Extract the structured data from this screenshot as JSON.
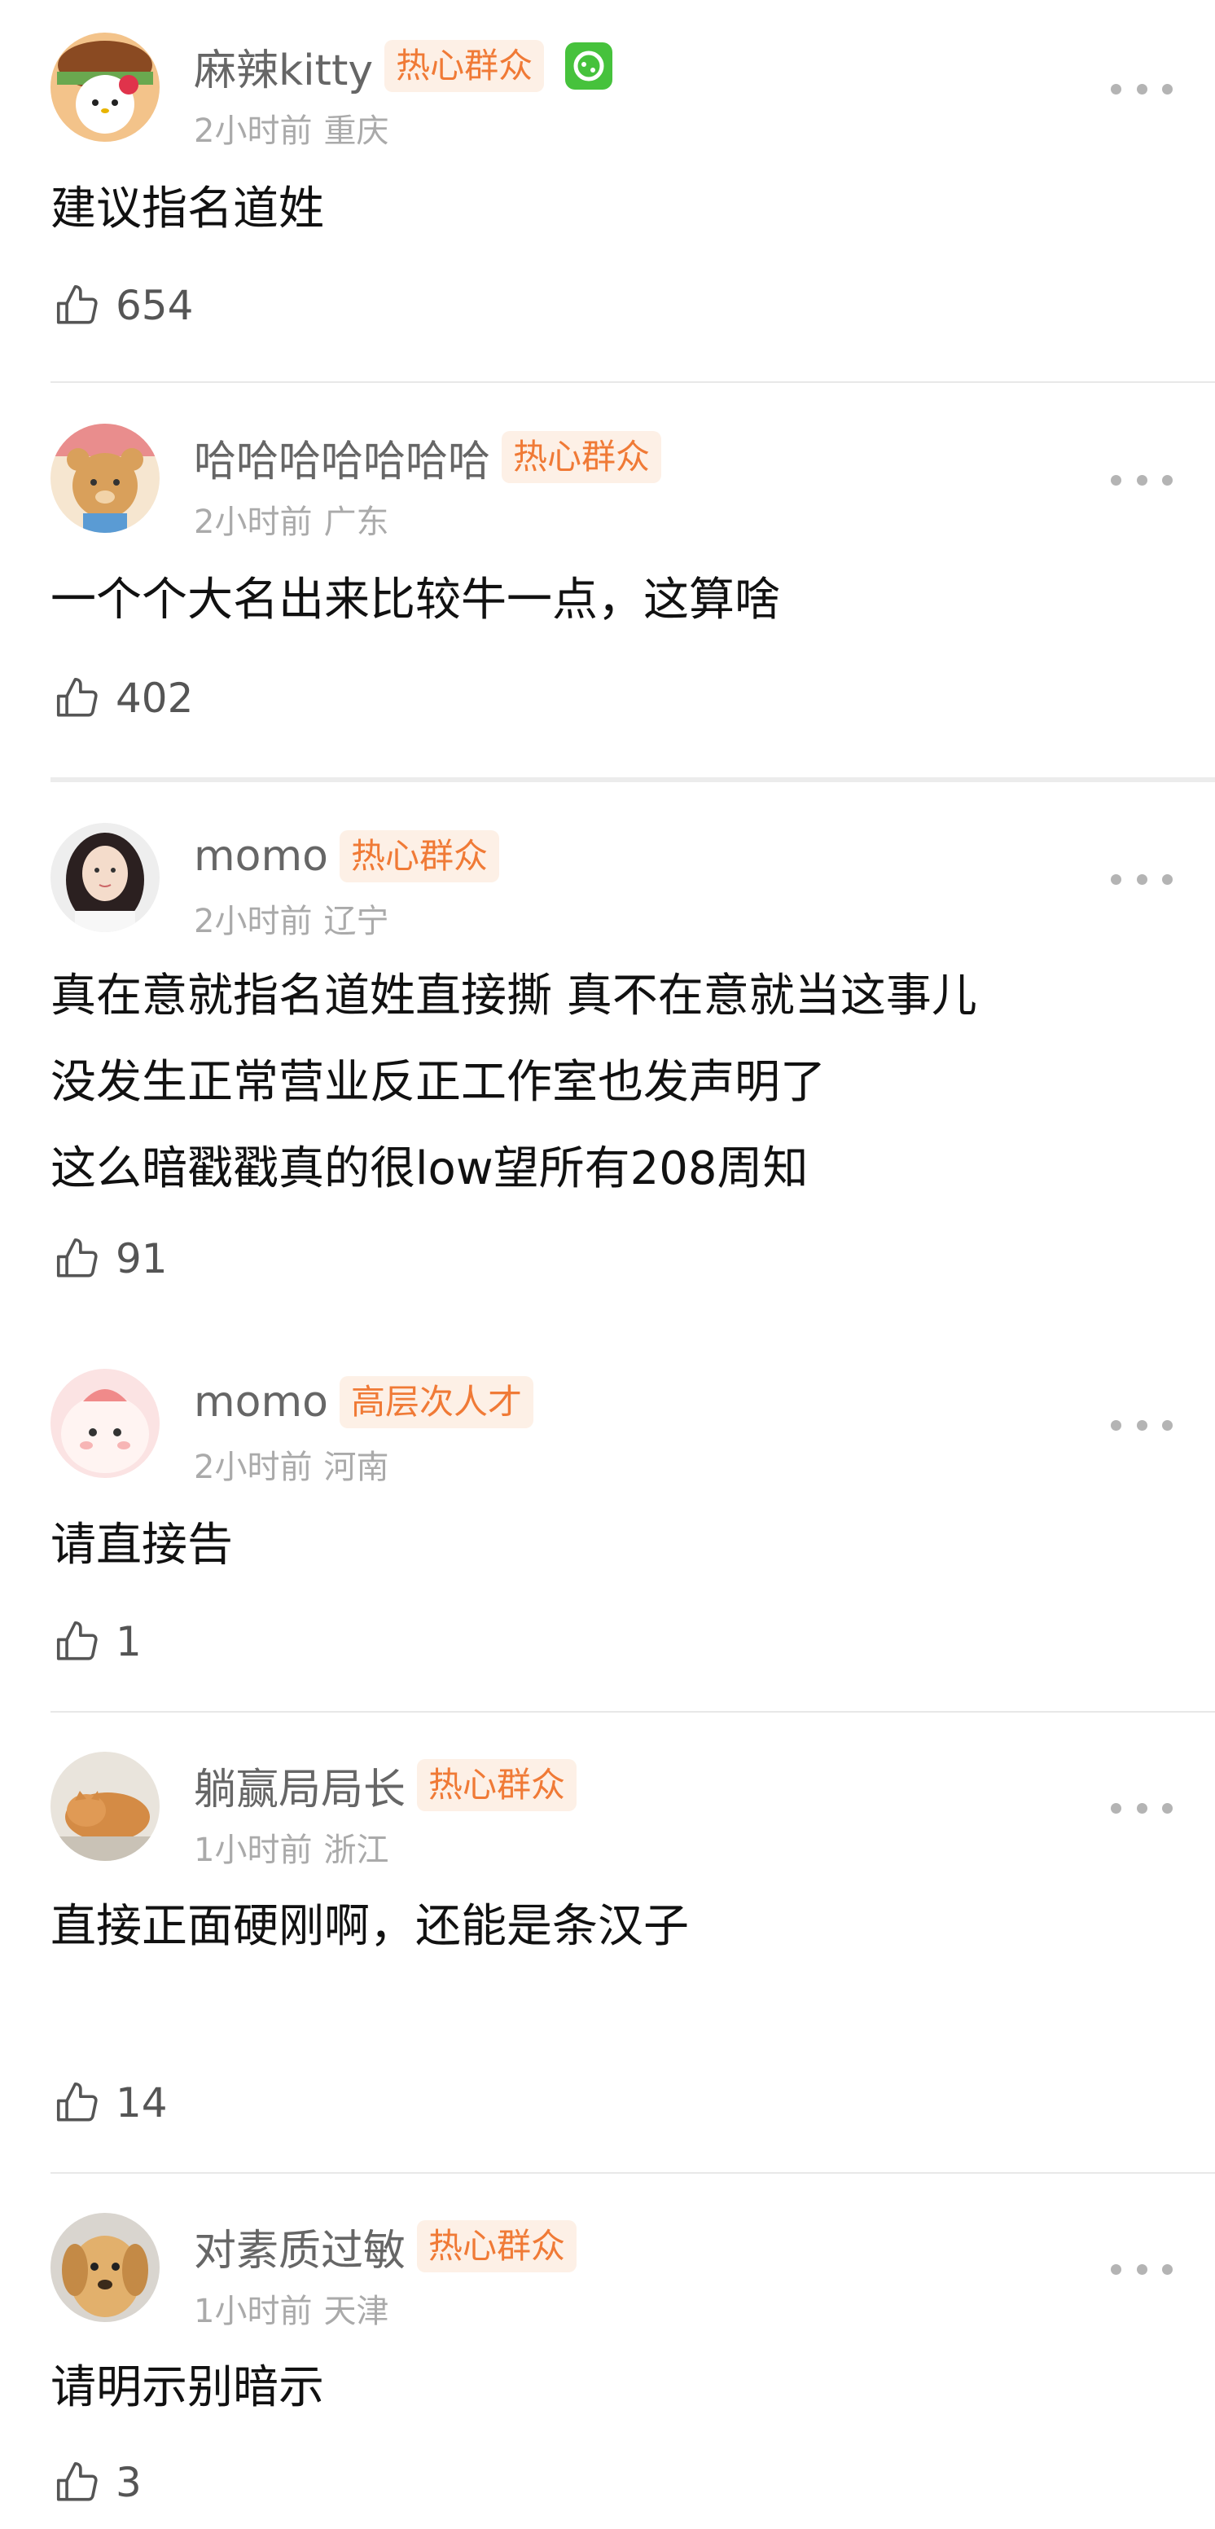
{
  "comments": [
    {
      "username": "麻辣kitty",
      "badge": "热心群众",
      "time": "2小时前",
      "location": "重庆",
      "lines": [
        "建议指名道姓"
      ],
      "likes": "654"
    },
    {
      "username": "哈哈哈哈哈哈哈",
      "badge": "热心群众",
      "time": "2小时前",
      "location": "广东",
      "lines": [
        "一个个大名出来比较牛一点，这算啥"
      ],
      "likes": "402"
    },
    {
      "username": "momo",
      "badge": "热心群众",
      "time": "2小时前",
      "location": "辽宁",
      "lines": [
        "真在意就指名道姓直接撕 真不在意就当这事儿",
        "没发生正常营业反正工作室也发声明了",
        "这么暗戳戳真的很low望所有208周知"
      ],
      "likes": "91"
    },
    {
      "username": "momo",
      "badge": "高层次人才",
      "time": "2小时前",
      "location": "河南",
      "lines": [
        "请直接告"
      ],
      "likes": "1"
    },
    {
      "username": "躺赢局局长",
      "badge": "热心群众",
      "time": "1小时前",
      "location": "浙江",
      "lines": [
        "直接正面硬刚啊，还能是条汉子"
      ],
      "likes": "14"
    },
    {
      "username": "对素质过敏",
      "badge": "热心群众",
      "time": "1小时前",
      "location": "天津",
      "lines": [
        "请明示别暗示"
      ],
      "likes": "3"
    }
  ],
  "icons": {
    "like": "thumbs-up-icon",
    "more": "more-icon",
    "vip": "vip-badge-icon"
  },
  "colors": {
    "badge_text": "#f07a36",
    "badge_bg": "#fdf0e6",
    "vip": "#46c23c"
  }
}
